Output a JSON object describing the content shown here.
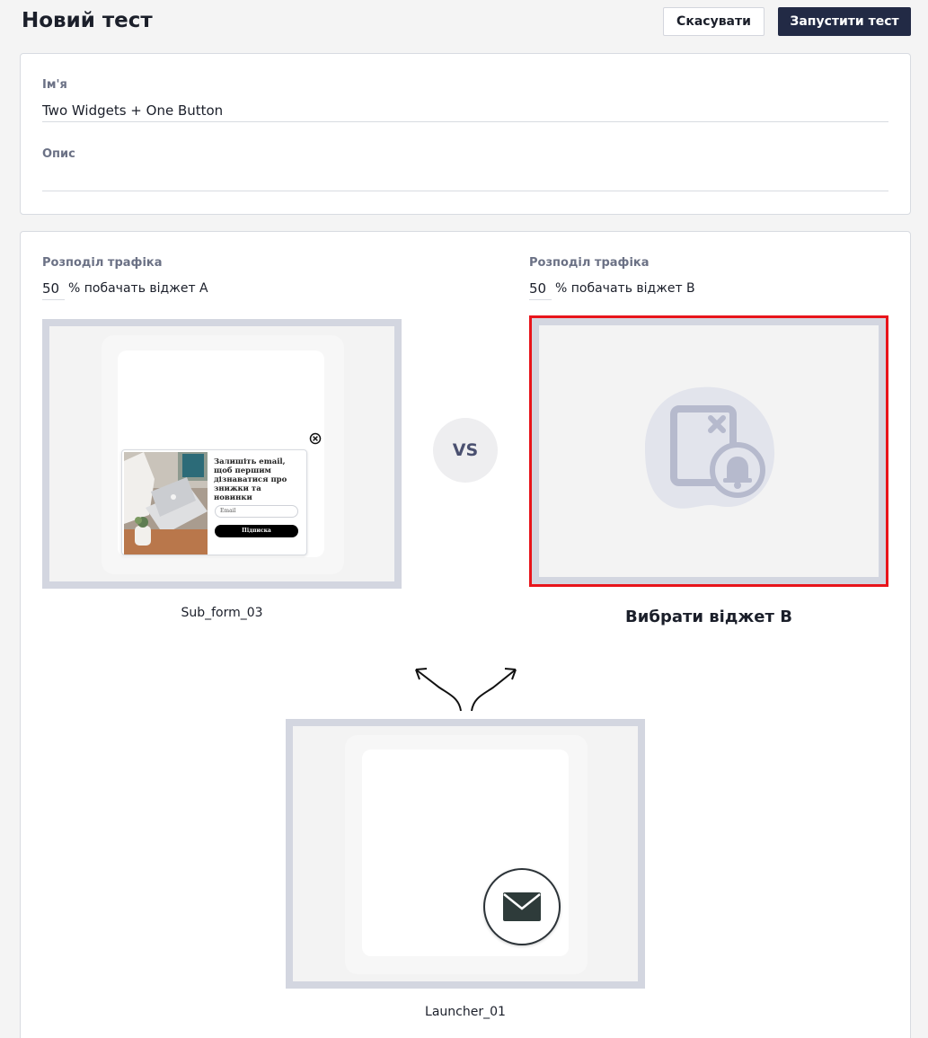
{
  "header": {
    "title": "Новий тест",
    "cancel_label": "Скасувати",
    "run_label": "Запустити тест"
  },
  "info": {
    "name_label": "Ім'я",
    "name_value": "Two Widgets + One Button",
    "description_label": "Опис",
    "description_value": ""
  },
  "test": {
    "variant_a": {
      "traffic_label": "Розподіл трафіка",
      "traffic_value": "50",
      "traffic_suffix": "% побачать віджет A",
      "widget_name": "Sub_form_03",
      "popup": {
        "text": "Залишіть email, щоб першим дізнаватися про знижки та новинки",
        "email_placeholder": "Email",
        "submit_label": "Підписка"
      }
    },
    "vs_label": "VS",
    "variant_b": {
      "traffic_label": "Розподіл трафіка",
      "traffic_value": "50",
      "traffic_suffix": "% побачать віджет B",
      "choose_label": "Вибрати віджет B"
    },
    "launcher": {
      "widget_name": "Launcher_01"
    }
  },
  "colors": {
    "primary": "#222a45",
    "highlight": "#e8141b",
    "frame": "#d3d6e0",
    "label": "#6b7185"
  }
}
